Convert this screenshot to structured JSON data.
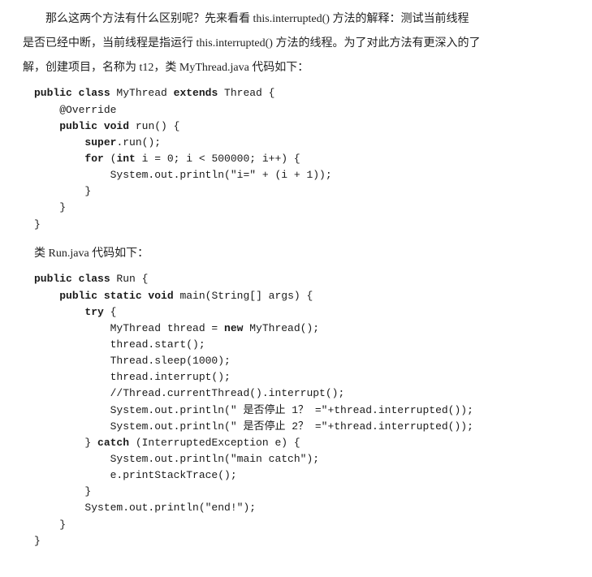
{
  "paragraphs": {
    "intro_l1": "那么这两个方法有什么区别呢？先来看看 this.interrupted() 方法的解释：测试当前线程",
    "intro_l2": "是否已经中断，当前线程是指运行 this.interrupted() 方法的线程。为了对此方法有更深入的了",
    "intro_l3": "解，创建项目，名称为 t12，类 MyThread.java 代码如下："
  },
  "code1": {
    "l01a": "public class",
    "l01b": " MyThread ",
    "l01c": "extends",
    "l01d": " Thread {",
    "l02": "    @Override",
    "l03a": "    ",
    "l03b": "public void",
    "l03c": " run() {",
    "l04a": "        ",
    "l04b": "super",
    "l04c": ".run();",
    "l05a": "        ",
    "l05b": "for",
    "l05c": " (",
    "l05d": "int",
    "l05e": " i = 0; i < 500000; i++) {",
    "l06": "            System.out.println(\"i=\" + (i + 1));",
    "l07": "        }",
    "l08": "    }",
    "l09": "}"
  },
  "midlabel": "类 Run.java 代码如下：",
  "code2": {
    "l01a": "public class",
    "l01b": " Run {",
    "l02a": "    ",
    "l02b": "public static void",
    "l02c": " main(String[] args) {",
    "l03a": "        ",
    "l03b": "try",
    "l03c": " {",
    "l04a": "            MyThread thread = ",
    "l04b": "new",
    "l04c": " MyThread();",
    "l05": "            thread.start();",
    "l06": "            Thread.sleep(1000);",
    "l07": "            thread.interrupt();",
    "l08": "            //Thread.currentThread().interrupt();",
    "l09": "            System.out.println(\" 是否停止 1？ =\"+thread.interrupted());",
    "l10": "            System.out.println(\" 是否停止 2？ =\"+thread.interrupted());",
    "l11a": "        } ",
    "l11b": "catch",
    "l11c": " (InterruptedException e) {",
    "l12": "            System.out.println(\"main catch\");",
    "l13": "            e.printStackTrace();",
    "l14": "        }",
    "l15": "        System.out.println(\"end!\");",
    "l16": "    }",
    "l17": "}"
  }
}
